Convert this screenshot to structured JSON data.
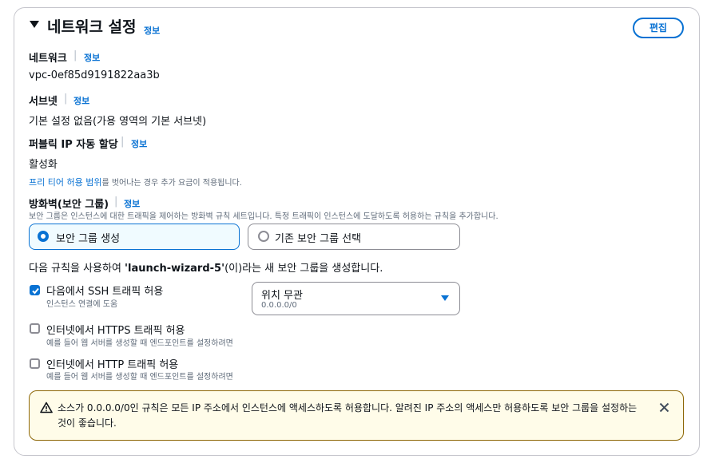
{
  "section": {
    "title": "네트워크 설정",
    "info_label": "정보",
    "edit_label": "편집"
  },
  "network": {
    "label": "네트워크",
    "info_label": "정보",
    "value": "vpc-0ef85d9191822aa3b"
  },
  "subnet": {
    "label": "서브넷",
    "info_label": "정보",
    "value": "기본 설정 없음(가용 영역의 기본 서브넷)"
  },
  "public_ip": {
    "label": "퍼블릭 IP 자동 할당",
    "info_label": "정보",
    "value": "활성화",
    "note_link": "프리 티어 허용 범위",
    "note_text": "를 벗어나는 경우 추가 요금이 적용됩니다."
  },
  "firewall": {
    "label": "방화벽(보안 그룹)",
    "info_label": "정보",
    "description": "보안 그룹은 인스턴스에 대한 트래픽을 제어하는 방화벽 규칙 세트입니다. 특정 트래픽이 인스턴스에 도달하도록 허용하는 규칙을 추가합니다.",
    "options": [
      {
        "label": "보안 그룹 생성",
        "selected": true
      },
      {
        "label": "기존 보안 그룹 선택",
        "selected": false
      }
    ],
    "rule_intro_prefix": "다음 규칙을 사용하여 ",
    "rule_intro_name": "'launch-wizard-5'",
    "rule_intro_suffix": "(이)라는 새 보안 그룹을 생성합니다."
  },
  "rules": [
    {
      "label": "다음에서 SSH 트래픽 허용",
      "sublabel": "인스턴스 연결에 도움",
      "checked": true
    },
    {
      "label": "인터넷에서 HTTPS 트래픽 허용",
      "sublabel": "예를 들어 웹 서버를 생성할 때 엔드포인트를 설정하려면",
      "checked": false
    },
    {
      "label": "인터넷에서 HTTP 트래픽 허용",
      "sublabel": "예를 들어 웹 서버를 생성할 때 엔드포인트를 설정하려면",
      "checked": false
    }
  ],
  "ssh_source": {
    "selected": "위치 무관",
    "sub": "0.0.0.0/0"
  },
  "warning": {
    "text": "소스가 0.0.0.0/0인 규칙은 모든 IP 주소에서 인스턴스에 액세스하도록 허용합니다. 알려진 IP 주소의 액세스만 허용하도록 보안 그룹을 설정하는 것이 좋습니다."
  },
  "colors": {
    "accent": "#0972d3",
    "warning_border": "#8d6605",
    "warning_bg": "#fffce9"
  },
  "icons": {
    "caret": "caret-down-icon",
    "warning": "warning-icon",
    "close": "close-icon",
    "dropdown": "dropdown-arrow-icon",
    "check": "check-icon"
  }
}
